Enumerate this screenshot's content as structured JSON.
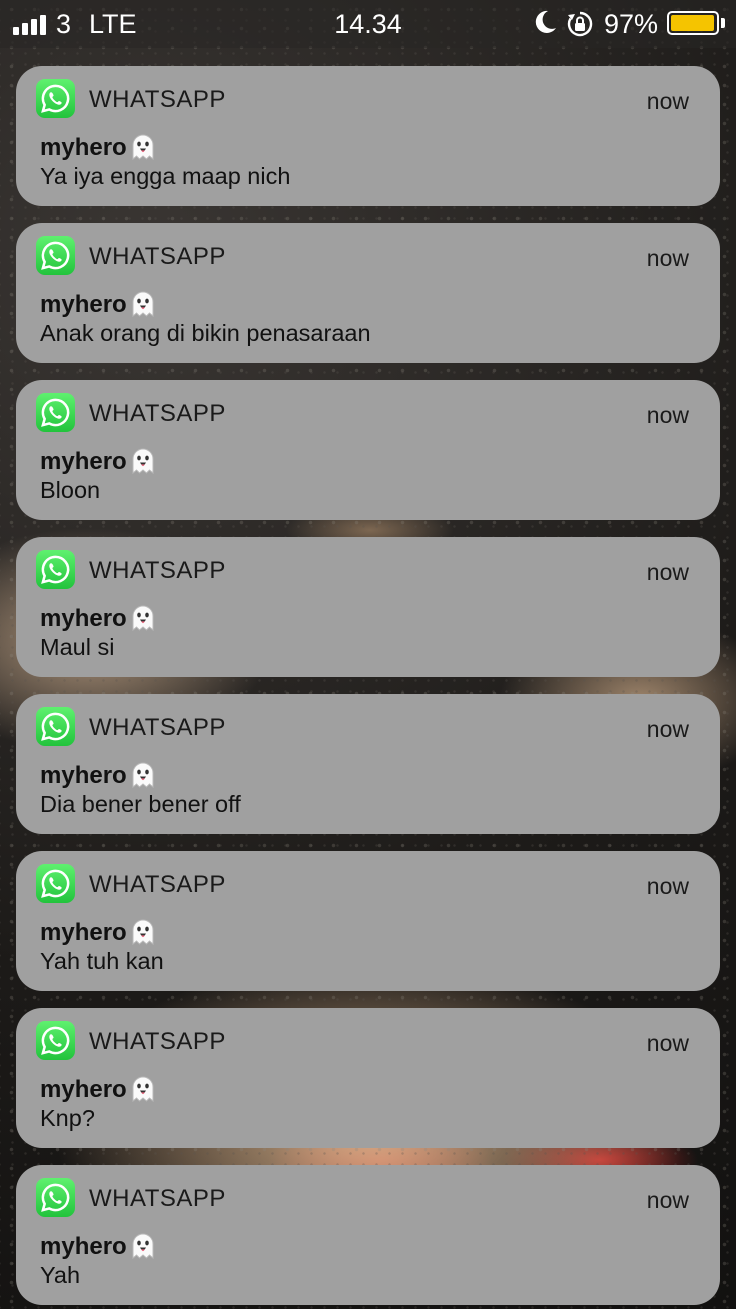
{
  "status_bar": {
    "carrier": "3",
    "network": "LTE",
    "time": "14.34",
    "battery_percent": "97%",
    "battery_level": 0.97,
    "battery_color": "#f5c400"
  },
  "notifications": [
    {
      "app": "WHATSAPP",
      "time": "now",
      "sender": "myhero",
      "sender_emoji": "ghost-icon",
      "message": "Ya iya engga maap nich"
    },
    {
      "app": "WHATSAPP",
      "time": "now",
      "sender": "myhero",
      "sender_emoji": "ghost-icon",
      "message": "Anak orang di bikin penasaraan"
    },
    {
      "app": "WHATSAPP",
      "time": "now",
      "sender": "myhero",
      "sender_emoji": "ghost-icon",
      "message": "Bloon"
    },
    {
      "app": "WHATSAPP",
      "time": "now",
      "sender": "myhero",
      "sender_emoji": "ghost-icon",
      "message": "Maul si"
    },
    {
      "app": "WHATSAPP",
      "time": "now",
      "sender": "myhero",
      "sender_emoji": "ghost-icon",
      "message": "Dia bener bener off"
    },
    {
      "app": "WHATSAPP",
      "time": "now",
      "sender": "myhero",
      "sender_emoji": "ghost-icon",
      "message": "Yah tuh kan"
    },
    {
      "app": "WHATSAPP",
      "time": "now",
      "sender": "myhero",
      "sender_emoji": "ghost-icon",
      "message": "Knp?"
    },
    {
      "app": "WHATSAPP",
      "time": "now",
      "sender": "myhero",
      "sender_emoji": "ghost-icon",
      "message": "Yah"
    }
  ],
  "colors": {
    "notification_bg": "#a0a0a0",
    "whatsapp_green": "#25d366"
  }
}
